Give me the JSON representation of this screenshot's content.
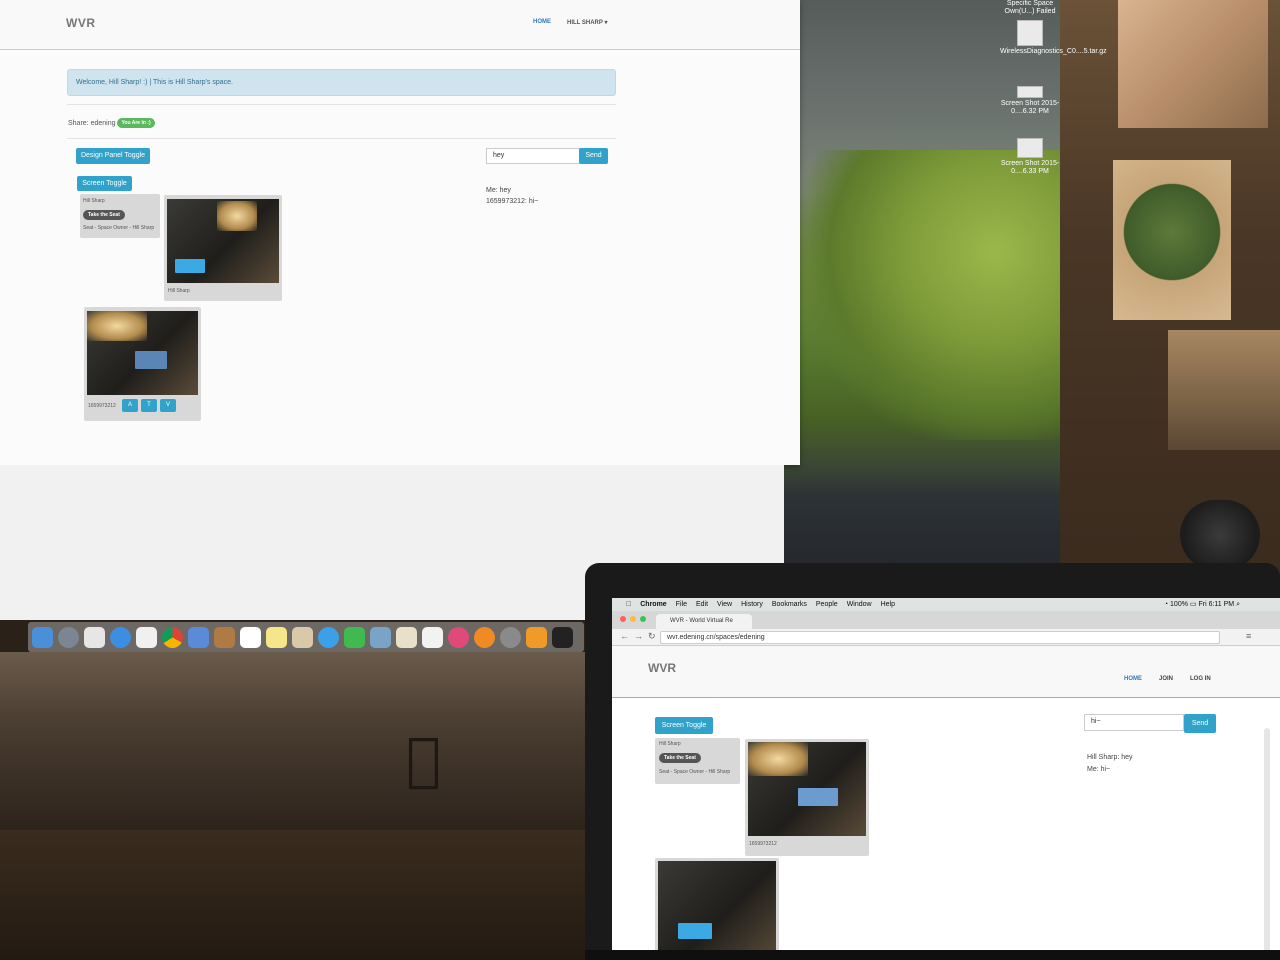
{
  "imac_page": {
    "brand": "WVR",
    "nav": {
      "home": "HOME",
      "user": "HILL SHARP ▾"
    },
    "welcome": "Welcome, Hill Sharp! :) | This is Hill Sharp's space.",
    "share_label": "Share: edening",
    "share_badge": "You Are In :)",
    "design_toggle": "Design Panel Toggle",
    "screen_toggle": "Screen Toggle",
    "chat_input_value": "hey",
    "send": "Send",
    "seat": {
      "name": "Hill Sharp",
      "take_seat": "Take the Seat",
      "caption": "Seat - Space Owner - Hill Sharp"
    },
    "video_main_caption": "Hill Sharp",
    "video_remote_caption": "1659973212",
    "remote_controls": [
      "A",
      "T",
      "V"
    ],
    "chat": [
      "Me: hey",
      "1659973212: hi~"
    ]
  },
  "desktop_icons": [
    {
      "label": "Specific Space Own(U...) Failed"
    },
    {
      "label": "WirelessDiagnostics_C0....5.tar.gz"
    },
    {
      "label": "Screen Shot 2015-0....6.32 PM"
    },
    {
      "label": "Screen Shot 2015-0....6.33 PM"
    }
  ],
  "macbook": {
    "menubar": {
      "app": "Chrome",
      "items": [
        "File",
        "Edit",
        "View",
        "History",
        "Bookmarks",
        "People",
        "Window",
        "Help"
      ],
      "battery": "100%",
      "clock": "Fri 6:11 PM"
    },
    "tab_title": "WVR - World Virtual Re",
    "url": "wvr.edening.cn/spaces/edening",
    "page": {
      "brand": "WVR",
      "nav": {
        "home": "HOME",
        "join": "JOIN",
        "login": "LOG IN"
      },
      "screen_toggle": "Screen Toggle",
      "chat_input_value": "hi~",
      "send": "Send",
      "seat": {
        "name": "Hill Sharp",
        "take_seat": "Take the Seat",
        "caption": "Seat - Space Owner - Hill Sharp"
      },
      "video_caption": "1659973212",
      "chat": [
        "Hill Sharp: hey",
        "Me: hi~"
      ]
    }
  }
}
